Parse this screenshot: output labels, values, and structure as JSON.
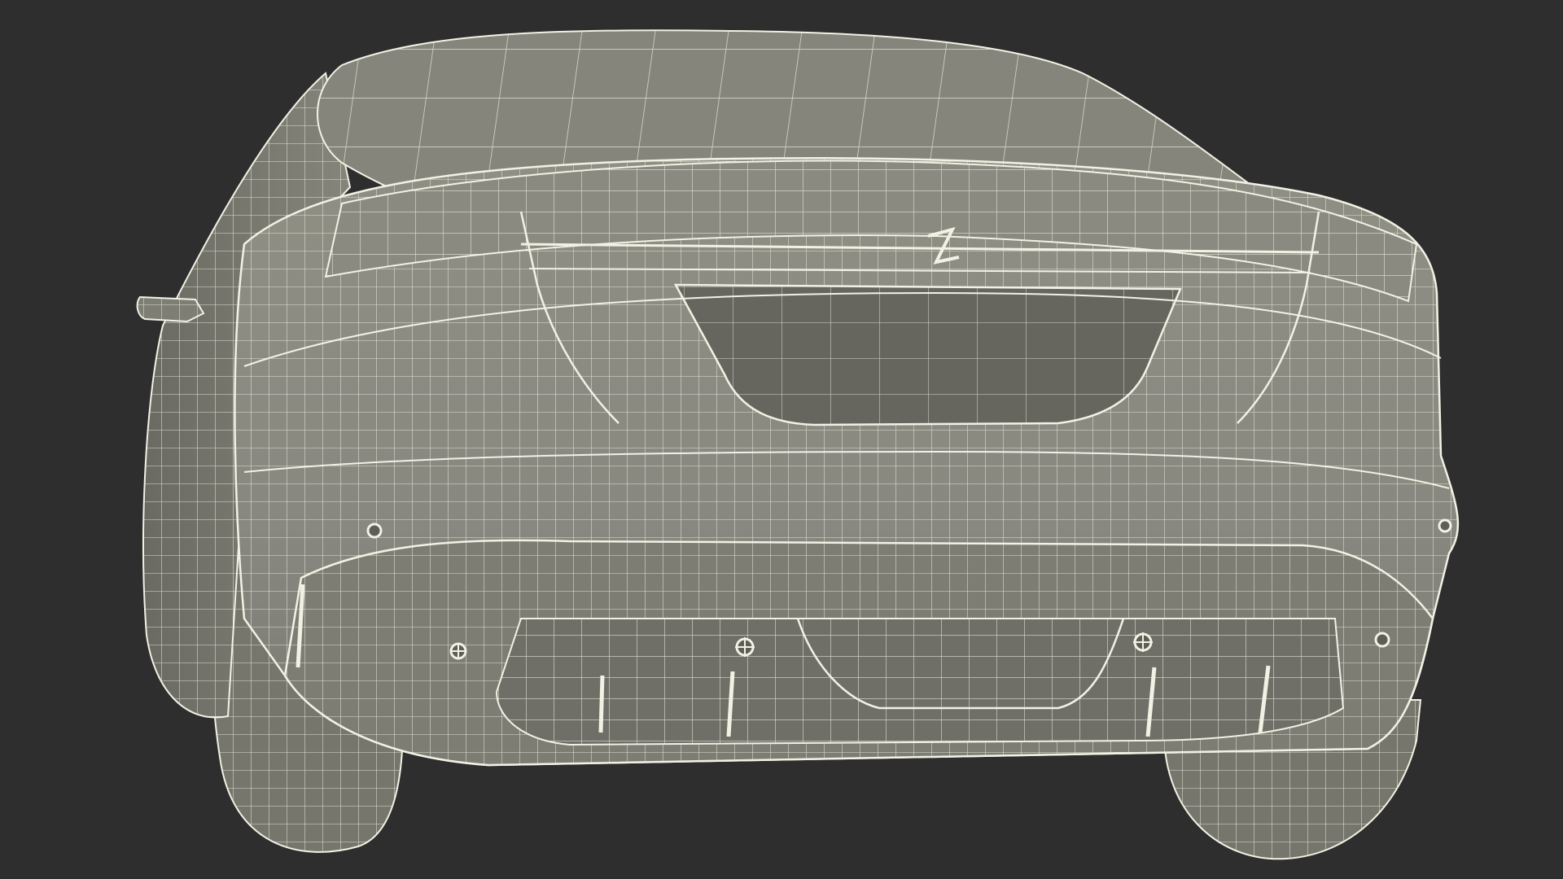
{
  "scene": {
    "subject": "car-rear-wireframe",
    "colors": {
      "background": "#2e2e2e",
      "body": "#8b8b7f",
      "body_shade": "#6f6f66",
      "body_dark": "#5d5d56",
      "recess": "#6a6a62",
      "wire": "#f1f1e4",
      "tire": "#7a7a70"
    }
  }
}
